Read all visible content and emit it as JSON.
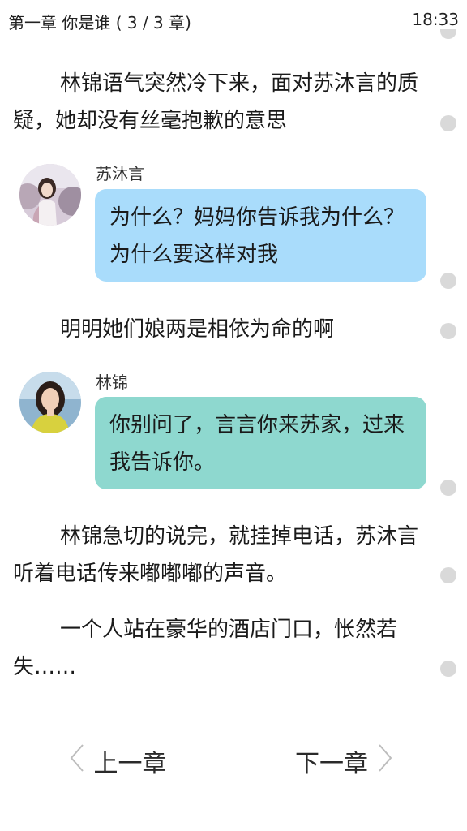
{
  "status": {
    "chapter": "第一章 你是谁 ( 3 / 3 章)",
    "time": "18:33"
  },
  "paragraphs": [
    "林锦语气突然冷下来，面对苏沐言的质疑，她却没有丝毫抱歉的意思",
    "明明她们娘两是相依为命的啊",
    "林锦急切的说完，就挂掉电话，苏沐言听着电话传来嘟嘟嘟的声音。",
    "一个人站在豪华的酒店门口，怅然若失……"
  ],
  "messages": [
    {
      "speaker": "苏沐言",
      "text": "为什么？妈妈你告诉我为什么？为什么要这样对我"
    },
    {
      "speaker": "林锦",
      "text": "你别问了，言言你来苏家，过来我告诉你。"
    }
  ],
  "nav": {
    "prev_label": "上一章",
    "next_label": "下一章"
  },
  "colors": {
    "bubble_blue": "#a9dcfb",
    "bubble_teal": "#8ed8cf",
    "indicator_dot": "#d9d9d9"
  },
  "icons": {
    "prev": "chevron-left-icon",
    "next": "chevron-right-icon"
  }
}
